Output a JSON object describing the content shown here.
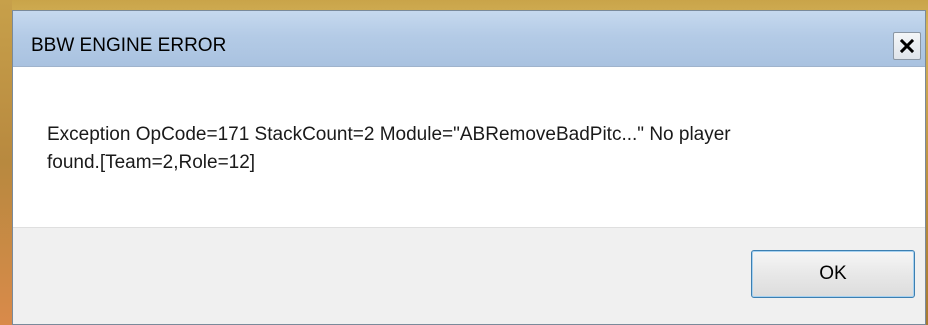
{
  "dialog": {
    "title": "BBW ENGINE ERROR",
    "close_icon": "close-icon",
    "message_line1": "Exception OpCode=171 StackCount=2 Module=\"ABRemoveBadPitc...\" No player",
    "message_line2": "found.[Team=2,Role=12]",
    "ok_label": "OK"
  },
  "colors": {
    "title_bar": "#b4cbe6",
    "button_area": "#f0f0f0",
    "ok_border": "#3c7fb1"
  }
}
